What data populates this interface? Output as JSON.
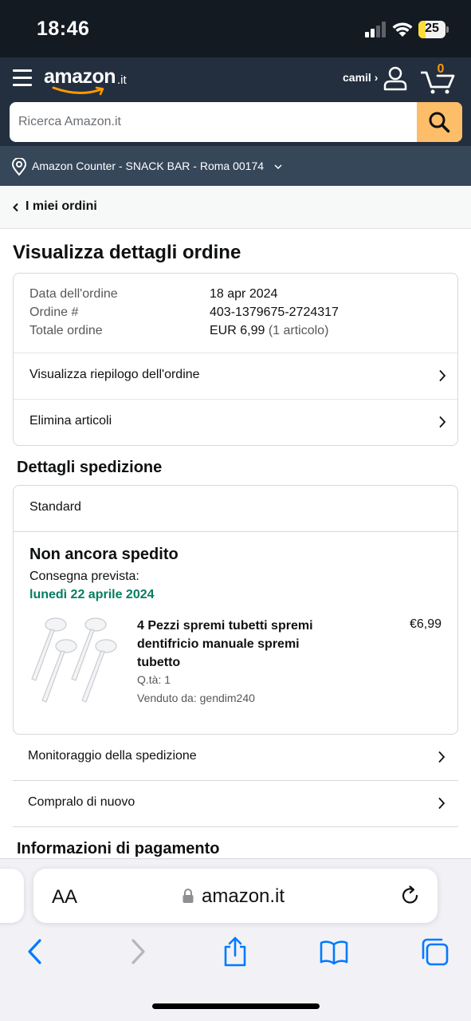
{
  "status_bar": {
    "time": "18:46",
    "battery": "25",
    "battery_level": 0.25
  },
  "header": {
    "logo_text": "amazon",
    "logo_tld": ".it",
    "account_label": "camil ›",
    "cart_count": "0",
    "search_placeholder": "Ricerca Amazon.it"
  },
  "location": {
    "text": "Amazon Counter - SNACK BAR - Roma 00174"
  },
  "breadcrumb": {
    "label": "I miei ordini"
  },
  "page": {
    "title": "Visualizza dettagli ordine"
  },
  "order_summary": {
    "rows": [
      {
        "label": "Data dell'ordine",
        "value": "18 apr 2024",
        "extra": ""
      },
      {
        "label": "Ordine #",
        "value": "403-1379675-2724317",
        "extra": ""
      },
      {
        "label": "Totale ordine",
        "value": "EUR 6,99",
        "extra": " (1 articolo)"
      }
    ],
    "links": [
      {
        "label": "Visualizza riepilogo dell'ordine"
      },
      {
        "label": "Elimina articoli"
      }
    ]
  },
  "shipping": {
    "section_title": "Dettagli spedizione",
    "method": "Standard",
    "status": "Non ancora spedito",
    "expected_label": "Consegna prevista:",
    "expected_date": "lunedì 22 aprile 2024",
    "product": {
      "title": "4 Pezzi spremi tubetti spremi dentifricio manuale spremi tubetto",
      "qty": "Q.tà: 1",
      "seller": "Venduto da: gendim240",
      "price": "€6,99"
    },
    "actions": [
      {
        "label": "Monitoraggio della spedizione"
      },
      {
        "label": "Compralo di nuovo"
      }
    ]
  },
  "payment": {
    "section_title": "Informazioni di pagamento"
  },
  "safari": {
    "aa_label": "AA",
    "url": "amazon.it"
  },
  "colors": {
    "status_bar_bg": "#131a22",
    "header_bg": "#232f3e",
    "location_bg": "#37475a",
    "search_button": "#febd69",
    "delivery_green": "#067d62",
    "cart_accent": "#ff9900",
    "safari_blue": "#007aff"
  }
}
